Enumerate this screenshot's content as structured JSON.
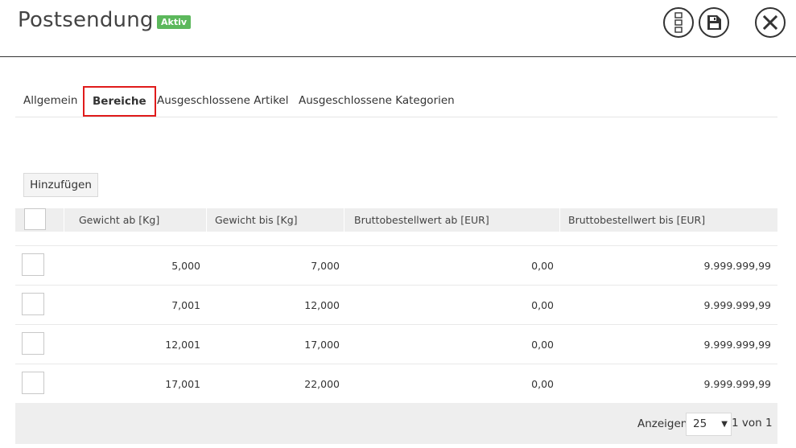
{
  "header": {
    "title": "Postsendung",
    "status_badge": "Aktiv",
    "status_color": "#5cb85c",
    "actions": [
      {
        "name": "columns-icon"
      },
      {
        "name": "save-icon"
      },
      {
        "name": "close-icon"
      }
    ]
  },
  "tabs": [
    {
      "label": "Allgemein",
      "active": false
    },
    {
      "label": "Bereiche",
      "active": true
    },
    {
      "label": "Ausgeschlossene Artikel",
      "active": false
    },
    {
      "label": "Ausgeschlossene Kategorien",
      "active": false
    }
  ],
  "toolbar": {
    "add_label": "Hinzufügen"
  },
  "table": {
    "columns": [
      "Gewicht ab [Kg]",
      "Gewicht bis [Kg]",
      "Bruttobestellwert ab [EUR]",
      "Bruttobestellwert bis [EUR]"
    ],
    "rows": [
      [
        "5,000",
        "7,000",
        "0,00",
        "9.999.999,99"
      ],
      [
        "7,001",
        "12,000",
        "0,00",
        "9.999.999,99"
      ],
      [
        "12,001",
        "17,000",
        "0,00",
        "9.999.999,99"
      ],
      [
        "17,001",
        "22,000",
        "0,00",
        "9.999.999,99"
      ]
    ]
  },
  "pagination": {
    "show_label": "Anzeigen",
    "page_size": "25",
    "page_info": "1 von 1"
  },
  "colors": {
    "active_tab_outline": "#e01b1b"
  }
}
